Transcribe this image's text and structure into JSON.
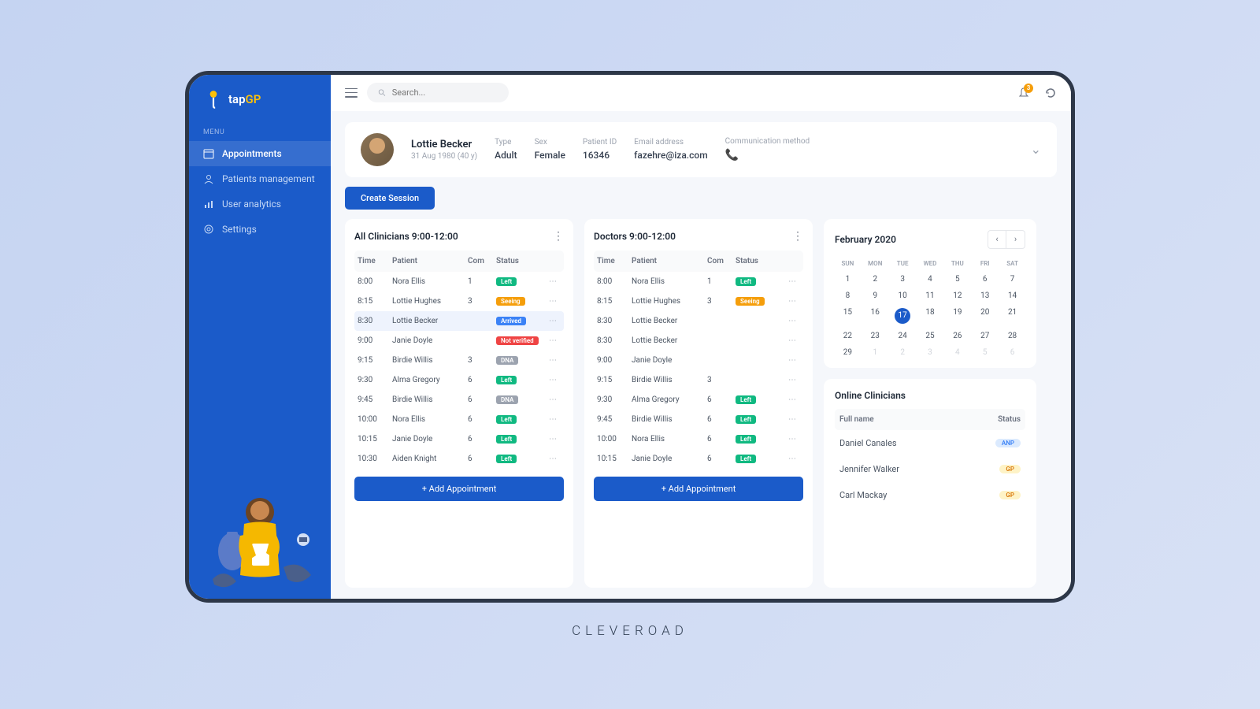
{
  "brand": {
    "name": "tap",
    "suffix": "GP"
  },
  "sidebar": {
    "menu_label": "MENU",
    "items": [
      {
        "label": "Appointments"
      },
      {
        "label": "Patients management"
      },
      {
        "label": "User analytics"
      },
      {
        "label": "Settings"
      }
    ]
  },
  "search": {
    "placeholder": "Search..."
  },
  "notifications": {
    "count": "3"
  },
  "patient": {
    "name": "Lottie Becker",
    "dob": "31 Aug 1980 (40 y)",
    "type_label": "Type",
    "type": "Adult",
    "sex_label": "Sex",
    "sex": "Female",
    "id_label": "Patient ID",
    "id": "16346",
    "email_label": "Email address",
    "email": "fazehre@iza.com",
    "comm_label": "Communication method"
  },
  "create_session": "Create Session",
  "columns": {
    "time": "Time",
    "patient": "Patient",
    "com": "Com",
    "status": "Status"
  },
  "panel1": {
    "title": "All Clinicians 9:00-12:00",
    "rows": [
      {
        "time": "8:00",
        "patient": "Nora Ellis",
        "com": "1",
        "status": "Left",
        "cls": "left"
      },
      {
        "time": "8:15",
        "patient": "Lottie Hughes",
        "com": "3",
        "status": "Seeing",
        "cls": "seeing"
      },
      {
        "time": "8:30",
        "patient": "Lottie Becker",
        "com": "",
        "status": "Arrived",
        "cls": "arrived",
        "selected": true
      },
      {
        "time": "9:00",
        "patient": "Janie Doyle",
        "com": "",
        "status": "Not verified",
        "cls": "notverified"
      },
      {
        "time": "9:15",
        "patient": "Birdie Willis",
        "com": "3",
        "status": "DNA",
        "cls": "dna"
      },
      {
        "time": "9:30",
        "patient": "Alma Gregory",
        "com": "6",
        "status": "Left",
        "cls": "left"
      },
      {
        "time": "9:45",
        "patient": "Birdie Willis",
        "com": "6",
        "status": "DNA",
        "cls": "dna"
      },
      {
        "time": "10:00",
        "patient": "Nora Ellis",
        "com": "6",
        "status": "Left",
        "cls": "left"
      },
      {
        "time": "10:15",
        "patient": "Janie Doyle",
        "com": "6",
        "status": "Left",
        "cls": "left"
      },
      {
        "time": "10:30",
        "patient": "Aiden Knight",
        "com": "6",
        "status": "Left",
        "cls": "left"
      }
    ],
    "add": "+ Add Appointment"
  },
  "panel2": {
    "title": "Doctors 9:00-12:00",
    "rows": [
      {
        "time": "8:00",
        "patient": "Nora Ellis",
        "com": "1",
        "status": "Left",
        "cls": "left"
      },
      {
        "time": "8:15",
        "patient": "Lottie Hughes",
        "com": "3",
        "status": "Seeing",
        "cls": "seeing"
      },
      {
        "time": "8:30",
        "patient": "Lottie Becker",
        "com": "",
        "status": "",
        "cls": ""
      },
      {
        "time": "8:30",
        "patient": "Lottie Becker",
        "com": "",
        "status": "",
        "cls": ""
      },
      {
        "time": "9:00",
        "patient": "Janie Doyle",
        "com": "",
        "status": "",
        "cls": ""
      },
      {
        "time": "9:15",
        "patient": "Birdie Willis",
        "com": "3",
        "status": "",
        "cls": ""
      },
      {
        "time": "9:30",
        "patient": "Alma Gregory",
        "com": "6",
        "status": "Left",
        "cls": "left"
      },
      {
        "time": "9:45",
        "patient": "Birdie Willis",
        "com": "6",
        "status": "Left",
        "cls": "left"
      },
      {
        "time": "10:00",
        "patient": "Nora Ellis",
        "com": "6",
        "status": "Left",
        "cls": "left"
      },
      {
        "time": "10:15",
        "patient": "Janie Doyle",
        "com": "6",
        "status": "Left",
        "cls": "left"
      }
    ],
    "add": "+ Add Appointment"
  },
  "calendar": {
    "title": "February 2020",
    "day_names": [
      "SUN",
      "MON",
      "TUE",
      "WED",
      "THU",
      "FRI",
      "SAT"
    ],
    "days": [
      {
        "d": "1"
      },
      {
        "d": "2"
      },
      {
        "d": "3"
      },
      {
        "d": "4"
      },
      {
        "d": "5"
      },
      {
        "d": "6"
      },
      {
        "d": "7"
      },
      {
        "d": "8"
      },
      {
        "d": "9"
      },
      {
        "d": "10"
      },
      {
        "d": "11"
      },
      {
        "d": "12"
      },
      {
        "d": "13"
      },
      {
        "d": "14"
      },
      {
        "d": "15"
      },
      {
        "d": "16"
      },
      {
        "d": "17",
        "today": true
      },
      {
        "d": "18"
      },
      {
        "d": "19"
      },
      {
        "d": "20"
      },
      {
        "d": "21"
      },
      {
        "d": "22"
      },
      {
        "d": "23"
      },
      {
        "d": "24"
      },
      {
        "d": "25"
      },
      {
        "d": "26"
      },
      {
        "d": "27"
      },
      {
        "d": "28"
      },
      {
        "d": "29"
      },
      {
        "d": "1",
        "muted": true
      },
      {
        "d": "2",
        "muted": true
      },
      {
        "d": "3",
        "muted": true
      },
      {
        "d": "4",
        "muted": true
      },
      {
        "d": "5",
        "muted": true
      },
      {
        "d": "6",
        "muted": true
      }
    ]
  },
  "online": {
    "title": "Online Clinicians",
    "name_col": "Full name",
    "status_col": "Status",
    "rows": [
      {
        "name": "Daniel Canales",
        "role": "ANP",
        "cls": "anp"
      },
      {
        "name": "Jennifer Walker",
        "role": "GP",
        "cls": "gp"
      },
      {
        "name": "Carl Mackay",
        "role": "GP",
        "cls": "gp"
      }
    ]
  },
  "footer": "CLEVEROAD"
}
